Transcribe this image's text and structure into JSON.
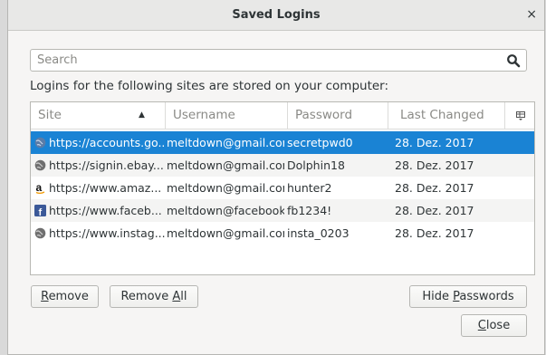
{
  "window": {
    "title": "Saved Logins",
    "close_glyph": "×"
  },
  "search": {
    "placeholder": "Search",
    "value": ""
  },
  "info_text": "Logins for the following sites are stored on your computer:",
  "columns": {
    "site": "Site",
    "username": "Username",
    "password": "Password",
    "last_changed": "Last Changed"
  },
  "sort": {
    "column": "site",
    "direction": "ascending",
    "glyph": "▲"
  },
  "rows": [
    {
      "site": "https://accounts.go...",
      "username": "meltdown@gmail.com",
      "password": "secretpwd0",
      "last_changed": "28. Dez. 2017",
      "icon": "globe-icon",
      "selected": true
    },
    {
      "site": "https://signin.ebay....",
      "username": "meltdown@gmail.com",
      "password": "Dolphin18",
      "last_changed": "28. Dez. 2017",
      "icon": "globe-icon",
      "selected": false
    },
    {
      "site": "https://www.amaz...",
      "username": "meltdown@gmail.com",
      "password": "hunter2",
      "last_changed": "28. Dez. 2017",
      "icon": "amazon-icon",
      "selected": false
    },
    {
      "site": "https://www.faceb...",
      "username": "meltdown@facebook...",
      "password": "fb1234!",
      "last_changed": "28. Dez. 2017",
      "icon": "facebook-icon",
      "selected": false
    },
    {
      "site": "https://www.instag...",
      "username": "meltdown@gmail.com",
      "password": "insta_0203",
      "last_changed": "28. Dez. 2017",
      "icon": "globe-icon",
      "selected": false
    }
  ],
  "buttons": {
    "remove": {
      "pre": "",
      "mnemonic": "R",
      "post": "emove"
    },
    "remove_all": {
      "pre": "Remove ",
      "mnemonic": "A",
      "post": "ll"
    },
    "hide_passwords": {
      "pre": "Hide ",
      "mnemonic": "P",
      "post": "asswords"
    },
    "close": {
      "pre": "",
      "mnemonic": "C",
      "post": "lose"
    }
  },
  "colors": {
    "selection": "#1a83d4",
    "window_bg": "#f6f5f4",
    "alt_row": "#f4f4f3"
  }
}
